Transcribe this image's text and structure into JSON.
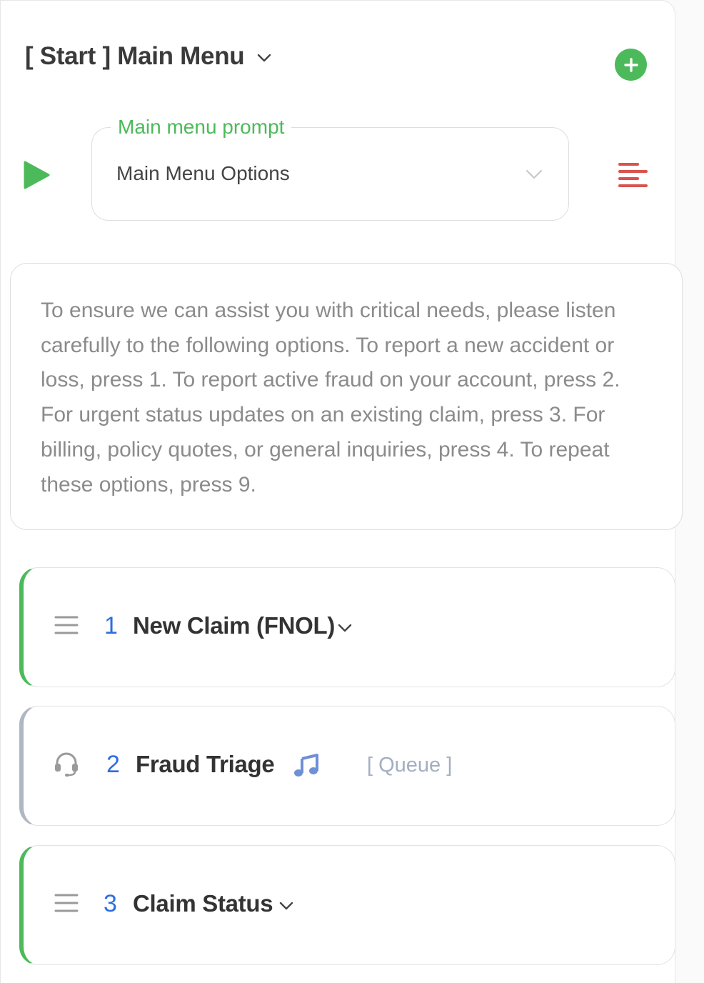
{
  "header": {
    "title": "[ Start ] Main Menu",
    "add_icon": "plus-circle-icon",
    "chevron_icon": "chevron-down-icon"
  },
  "prompt": {
    "legend": "Main menu prompt",
    "selected": "Main Menu Options",
    "play_icon": "play-icon",
    "text_align_icon": "align-left-icon",
    "text": "To ensure we can assist you with critical needs, please listen carefully to the following options. To report a new accident or loss, press 1. To report active fraud on your account, press 2. For urgent status updates on an existing claim, press 3. For billing, policy quotes, or general inquiries, press 4. To repeat these options, press 9."
  },
  "options": [
    {
      "number": "1",
      "label": "New Claim (FNOL)",
      "icon": "drag-handle-icon",
      "expandable": true
    },
    {
      "number": "2",
      "label": "Fraud Triage",
      "icon": "headset-icon",
      "media_icon": "music-note-icon",
      "type_label": "[ Queue ]"
    },
    {
      "number": "3",
      "label": "Claim Status",
      "icon": "drag-handle-icon",
      "expandable": true
    }
  ],
  "colors": {
    "accent_green": "#4cba5a",
    "number_blue": "#2d6de0",
    "danger_red": "#d9534f",
    "muted_gray": "#b0b7c3",
    "queue_blue": "#a3aec0"
  }
}
